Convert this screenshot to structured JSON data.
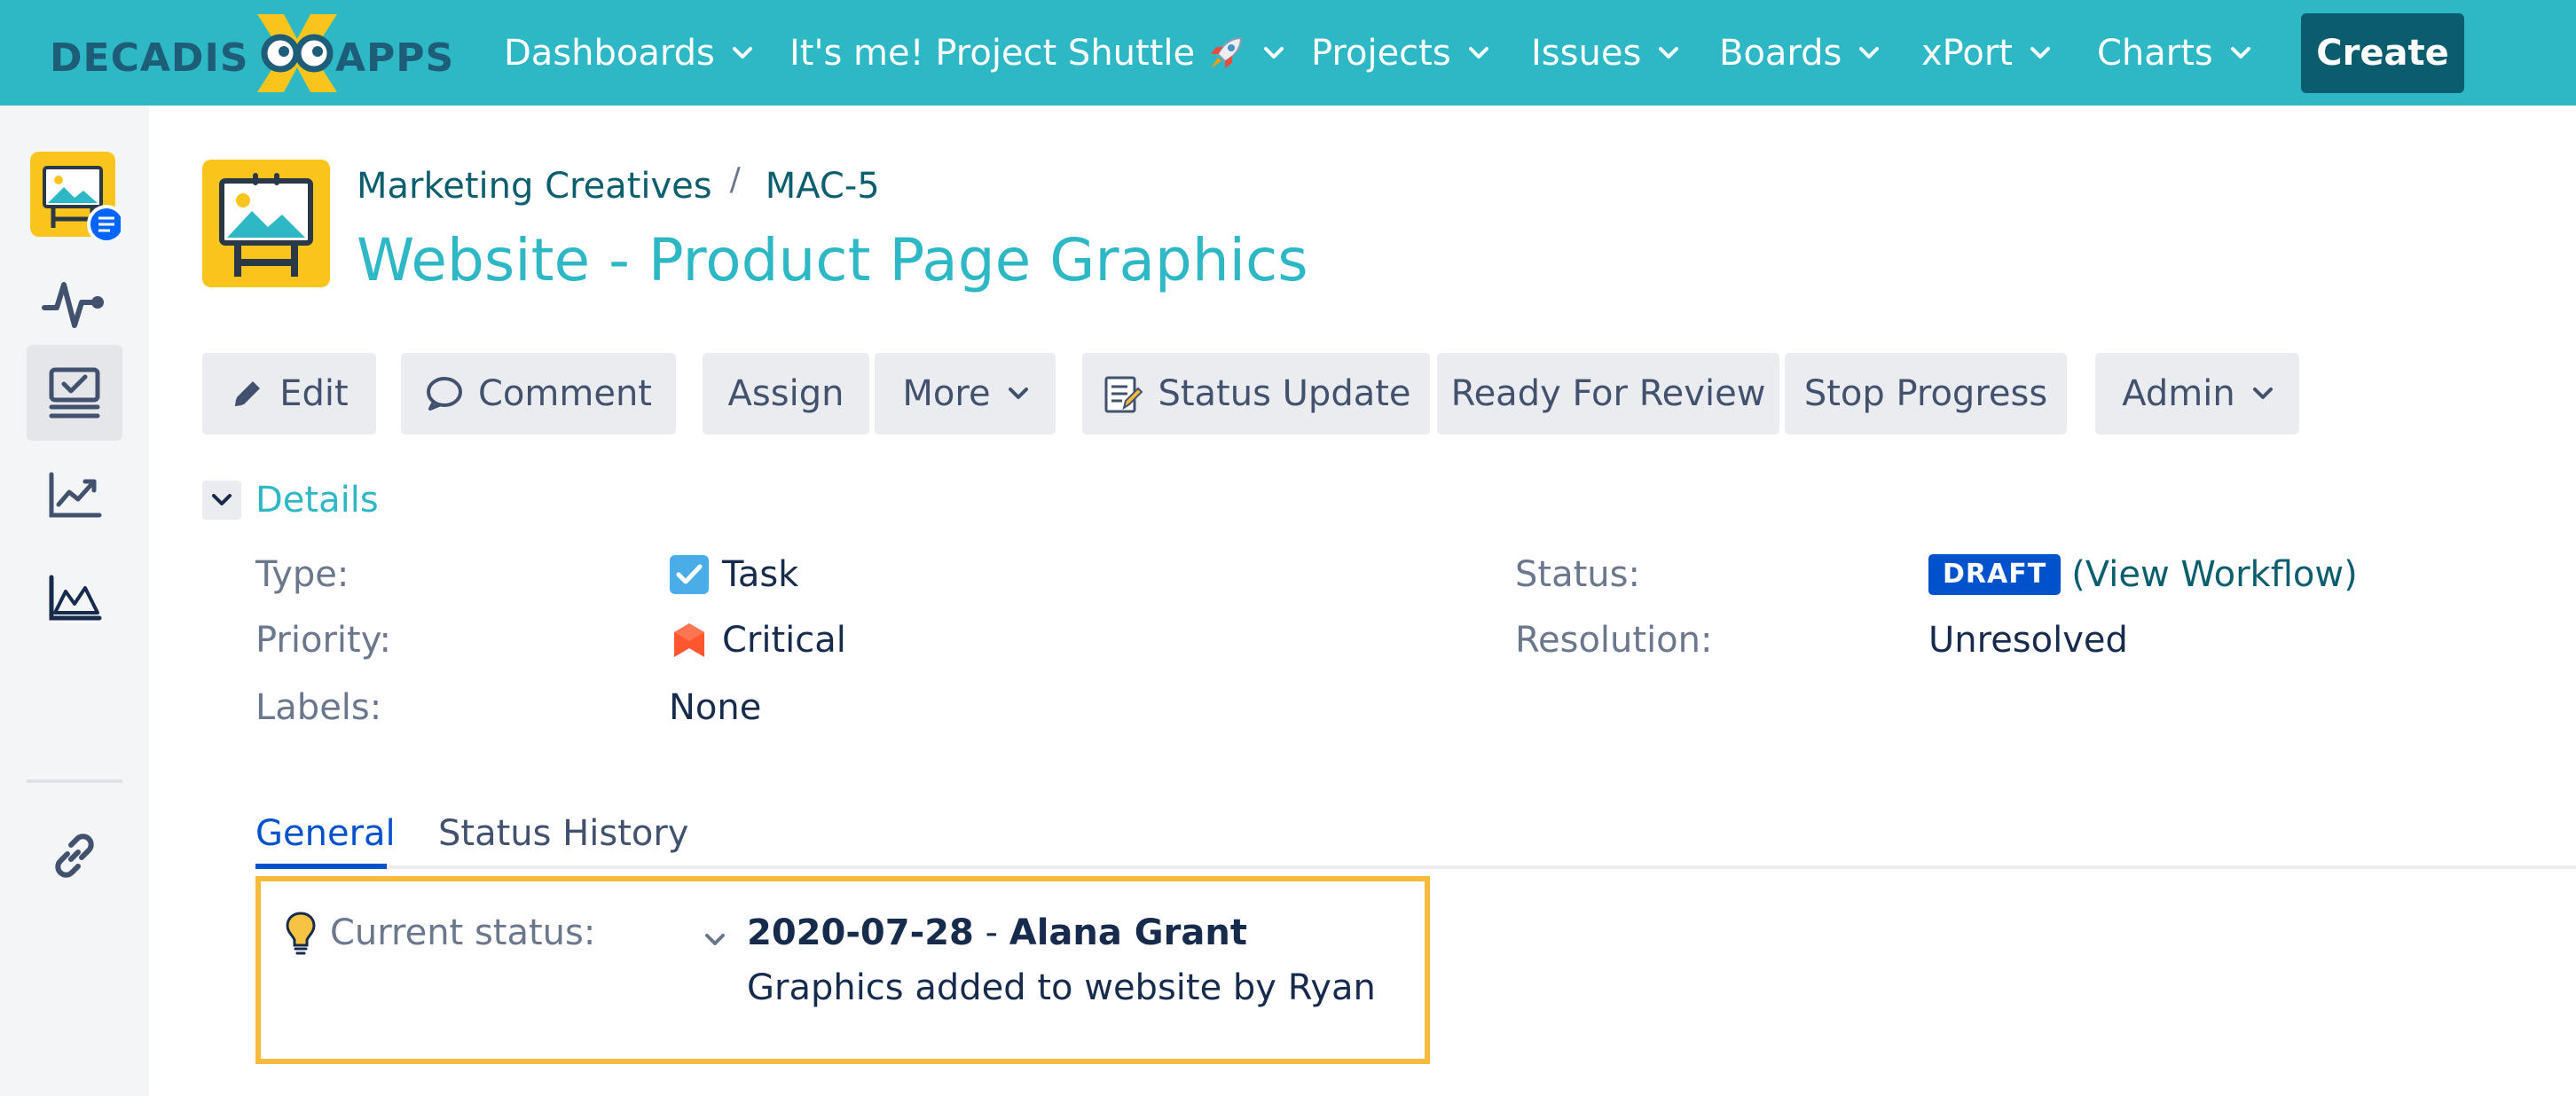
{
  "brand": {
    "logo_left": "DECADIS",
    "logo_right": "APPS"
  },
  "nav": {
    "items": [
      {
        "label": "Dashboards"
      },
      {
        "label": "It's me! Project Shuttle"
      },
      {
        "label": "Projects"
      },
      {
        "label": "Issues"
      },
      {
        "label": "Boards"
      },
      {
        "label": "xPort"
      },
      {
        "label": "Charts"
      }
    ],
    "create_label": "Create"
  },
  "sidebar": {
    "items": [
      {
        "icon": "project-avatar-icon"
      },
      {
        "icon": "activity-icon"
      },
      {
        "icon": "issues-board-icon",
        "active": true
      },
      {
        "icon": "trend-chart-icon"
      },
      {
        "icon": "area-chart-icon"
      },
      {
        "icon": "link-icon"
      }
    ]
  },
  "breadcrumb": {
    "project": "Marketing Creatives",
    "separator": "/",
    "issue_key": "MAC-5"
  },
  "issue": {
    "title": "Website - Product Page Graphics"
  },
  "toolbar": {
    "edit": "Edit",
    "comment": "Comment",
    "assign": "Assign",
    "more": "More",
    "status_update": "Status Update",
    "ready_for_review": "Ready For Review",
    "stop_progress": "Stop Progress",
    "admin": "Admin"
  },
  "details": {
    "heading": "Details",
    "type_label": "Type:",
    "type_value": "Task",
    "priority_label": "Priority:",
    "priority_value": "Critical",
    "labels_label": "Labels:",
    "labels_value": "None",
    "status_label": "Status:",
    "status_value": "DRAFT",
    "view_workflow": "(View Workflow)",
    "resolution_label": "Resolution:",
    "resolution_value": "Unresolved"
  },
  "tabs": [
    {
      "label": "General",
      "active": true
    },
    {
      "label": "Status History",
      "active": false
    }
  ],
  "current_status": {
    "label": "Current status:",
    "date": "2020-07-28",
    "separator": "-",
    "author": "Alana Grant",
    "note": "Graphics added to website by Ryan"
  },
  "colors": {
    "topbar": "#2eb7c5",
    "create_button": "#0b5d6e",
    "title": "#2eb7c5",
    "draft_badge": "#0052cc",
    "highlight_border": "#f6bb3b",
    "priority_critical": "#ff5630"
  }
}
